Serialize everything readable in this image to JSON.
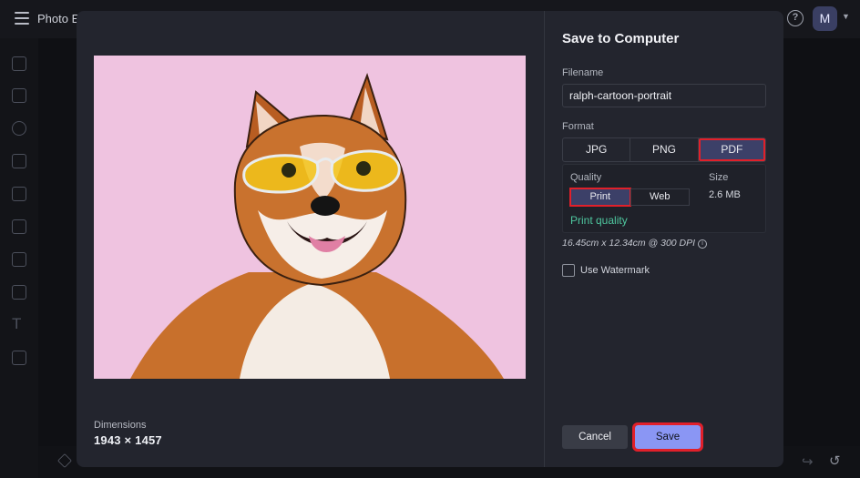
{
  "app": {
    "title": "Photo Editor"
  },
  "dialog": {
    "title": "Save to Computer",
    "filename": {
      "label": "Filename",
      "value": "ralph-cartoon-portrait"
    },
    "format": {
      "label": "Format",
      "options": [
        "JPG",
        "PNG",
        "PDF"
      ],
      "selected": "PDF"
    },
    "quality": {
      "label": "Quality",
      "options": [
        "Print",
        "Web"
      ],
      "selected": "Print",
      "description": "Print quality"
    },
    "size": {
      "label": "Size",
      "value": "2.6 MB"
    },
    "print_info": "16.45cm x 12.34cm @ 300 DPI",
    "watermark": {
      "label": "Use Watermark",
      "checked": false
    },
    "dimensions": {
      "label": "Dimensions",
      "value": "1943 × 1457"
    },
    "cancel_label": "Cancel",
    "save_label": "Save"
  },
  "avatar_initial": "M",
  "colors": {
    "accent": "#8a96f4",
    "selected": "#3c4068",
    "highlight": "#e1202a",
    "quality_text": "#4fc79f",
    "image_bg": "#efc3e0"
  }
}
